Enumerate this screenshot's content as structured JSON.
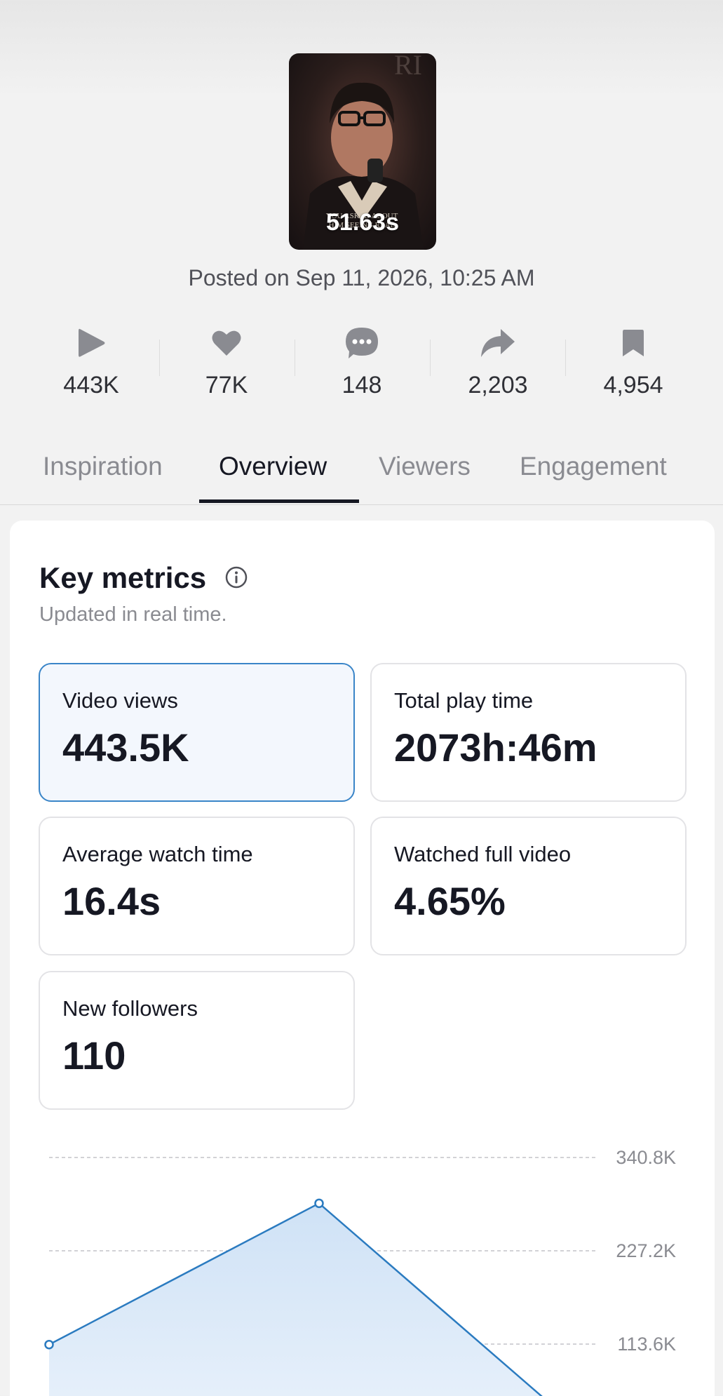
{
  "video": {
    "duration": "51.63s",
    "posted": "Posted on Sep 11, 2026, 10:25 AM"
  },
  "stats": [
    {
      "icon": "play-icon",
      "value": "443K"
    },
    {
      "icon": "heart-icon",
      "value": "77K"
    },
    {
      "icon": "comment-icon",
      "value": "148"
    },
    {
      "icon": "share-icon",
      "value": "2,203"
    },
    {
      "icon": "bookmark-icon",
      "value": "4,954"
    }
  ],
  "tabs": [
    {
      "label": "Inspiration",
      "active": false
    },
    {
      "label": "Overview",
      "active": true
    },
    {
      "label": "Viewers",
      "active": false
    },
    {
      "label": "Engagement",
      "active": false
    }
  ],
  "key_metrics": {
    "title": "Key metrics",
    "subtitle": "Updated in real time.",
    "items": [
      {
        "label": "Video views",
        "value": "443.5K",
        "selected": true
      },
      {
        "label": "Total play time",
        "value": "2073h:46m",
        "selected": false
      },
      {
        "label": "Average watch time",
        "value": "16.4s",
        "selected": false
      },
      {
        "label": "Watched full video",
        "value": "4.65%",
        "selected": false
      },
      {
        "label": "New followers",
        "value": "110",
        "selected": false
      }
    ]
  },
  "colors": {
    "accent": "#2b7bc0",
    "fill": "#d6e6f7",
    "text": "#161823",
    "muted": "#8a8b91"
  },
  "chart_data": {
    "type": "area",
    "title": "",
    "xlabel": "",
    "ylabel": "",
    "ylim": [
      0,
      340800
    ],
    "yticks": [
      {
        "value": 340800,
        "label": "340.8K"
      },
      {
        "value": 227200,
        "label": "227.2K"
      },
      {
        "value": 113600,
        "label": "113.6K"
      }
    ],
    "series": [
      {
        "values": [
          113000,
          285000,
          0
        ]
      }
    ],
    "grid": "dashed horizontal",
    "axis_position": "right"
  }
}
